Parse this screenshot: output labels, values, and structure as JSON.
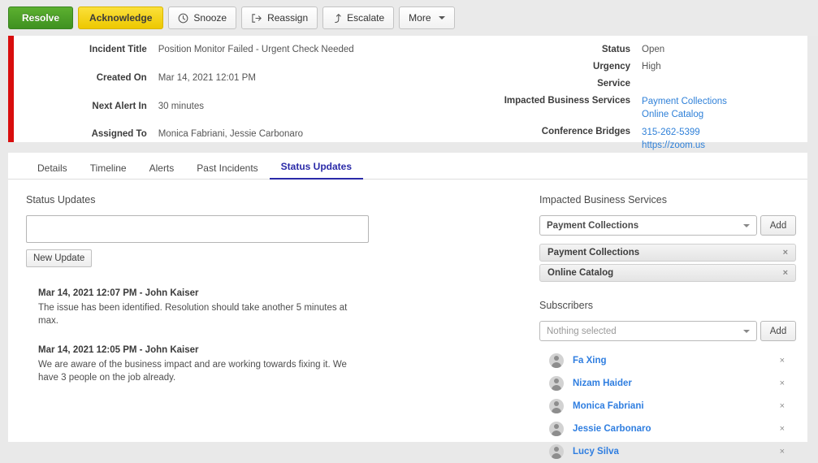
{
  "toolbar": {
    "buttons": [
      {
        "label": "Resolve",
        "icon": "",
        "style": "resolve"
      },
      {
        "label": "Acknowledge",
        "icon": "",
        "style": "ack"
      },
      {
        "label": "Snooze",
        "icon": "clock-icon",
        "style": "plain"
      },
      {
        "label": "Reassign",
        "icon": "sign-out-icon",
        "style": "plain"
      },
      {
        "label": "Escalate",
        "icon": "arrow-level-up-icon",
        "style": "plain"
      },
      {
        "label": "More",
        "icon": "caret-down-icon",
        "style": "plain"
      }
    ]
  },
  "summary": {
    "accent_color": "#d80d0d",
    "left_fields": [
      {
        "label": "Incident Title",
        "value": "Position Monitor Failed - Urgent Check Needed"
      },
      {
        "label": "Created On",
        "value": "Mar 14, 2021 12:01 PM"
      },
      {
        "label": "Next Alert In",
        "value": "30 minutes"
      },
      {
        "label": "Assigned To",
        "value": "Monica Fabriani, Jessie Carbonaro"
      }
    ],
    "right_fields": [
      {
        "label": "Status",
        "value": "Open",
        "links": []
      },
      {
        "label": "Urgency",
        "value": "High",
        "links": []
      },
      {
        "label": "Service",
        "value": "",
        "links": []
      },
      {
        "label": "Impacted Business Services",
        "value": "",
        "links": [
          "Payment Collections",
          "Online Catalog"
        ]
      },
      {
        "label": "Conference Bridges",
        "value": "",
        "links": [
          "315-262-5399",
          "https://zoom.us"
        ]
      }
    ]
  },
  "tabs": [
    {
      "label": "Details",
      "active": false
    },
    {
      "label": "Timeline",
      "active": false
    },
    {
      "label": "Alerts",
      "active": false
    },
    {
      "label": "Past Incidents",
      "active": false
    },
    {
      "label": "Status Updates",
      "active": true
    }
  ],
  "status_updates": {
    "section_title": "Status Updates",
    "textarea_value": "",
    "textarea_placeholder": "",
    "new_update_label": "New Update",
    "items": [
      {
        "header": "Mar 14, 2021 12:07 PM - John Kaiser",
        "text": "The issue has been identified. Resolution should take another 5 minutes at max."
      },
      {
        "header": "Mar 14, 2021 12:05 PM - John Kaiser",
        "text": "We are aware of the business impact and are working towards fixing it. We have 3 people on the job already."
      }
    ]
  },
  "impacted_services": {
    "section_title": "Impacted Business Services",
    "selected": "Payment Collections",
    "add_label": "Add",
    "remove_glyph": "×",
    "chips": [
      "Payment Collections",
      "Online Catalog"
    ]
  },
  "subscribers": {
    "section_title": "Subscribers",
    "selected": "Nothing selected",
    "add_label": "Add",
    "remove_glyph": "×",
    "link_color": "#2f7ee0",
    "items": [
      {
        "name": "Fa Xing"
      },
      {
        "name": "Nizam Haider"
      },
      {
        "name": "Monica Fabriani"
      },
      {
        "name": "Jessie Carbonaro"
      },
      {
        "name": "Lucy Silva"
      }
    ]
  }
}
